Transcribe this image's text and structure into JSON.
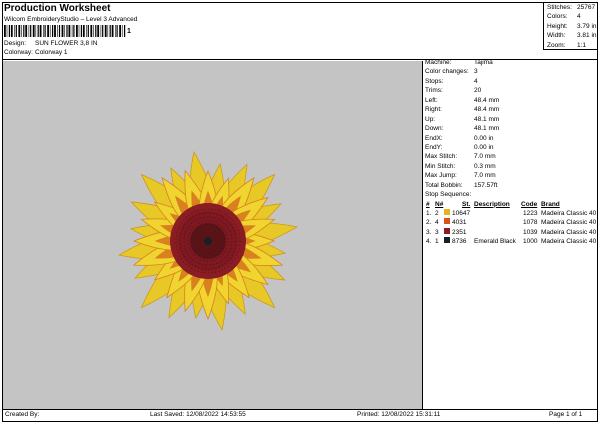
{
  "header": {
    "title": "Production Worksheet",
    "subtitle": "Wilcom EmbroideryStudio – Level 3 Advanced",
    "barcode_number": "1",
    "design_label": "Design:",
    "design_value": "SUN FLOWER 3,8 IN",
    "colorway_label": "Colorway:",
    "colorway_value": "Colorway 1"
  },
  "stats": [
    {
      "label": "Stitches:",
      "value": "25767"
    },
    {
      "label": "Colors:",
      "value": "4"
    },
    {
      "label": "Height:",
      "value": "3.79 in"
    },
    {
      "label": "Width:",
      "value": "3.81 in"
    },
    {
      "label": "Zoom:",
      "value": "1:1"
    }
  ],
  "machine_info": [
    {
      "label": "Machine:",
      "value": "Tajima"
    },
    {
      "label": "Color changes:",
      "value": "3"
    },
    {
      "label": "Stops:",
      "value": "4"
    },
    {
      "label": "Trims:",
      "value": "20"
    },
    {
      "label": "Left:",
      "value": "48.4 mm"
    },
    {
      "label": "Right:",
      "value": "48.4 mm"
    },
    {
      "label": "Up:",
      "value": "48.1 mm"
    },
    {
      "label": "Down:",
      "value": "48.1 mm"
    },
    {
      "label": "EndX:",
      "value": "0.00 in"
    },
    {
      "label": "EndY:",
      "value": "0.00 in"
    },
    {
      "label": "Max Stitch:",
      "value": "7.0 mm"
    },
    {
      "label": "Min Stitch:",
      "value": "0.3 mm"
    },
    {
      "label": "Max Jump:",
      "value": "7.0 mm"
    },
    {
      "label": "Total Bobbin:",
      "value": "157.57ft"
    }
  ],
  "stop_sequence": {
    "title": "Stop Sequence:",
    "headers": {
      "num": "#",
      "n": "N#",
      "st": "St.",
      "description": "Description",
      "code": "Code",
      "brand": "Brand"
    },
    "rows": [
      {
        "num": "1.",
        "n": "2",
        "color": "#e8b21c",
        "st": "10647",
        "description": "",
        "code": "1223",
        "brand": "Madeira Classic 40"
      },
      {
        "num": "2.",
        "n": "4",
        "color": "#d9531e",
        "st": "4031",
        "description": "",
        "code": "1078",
        "brand": "Madeira Classic 40"
      },
      {
        "num": "3.",
        "n": "3",
        "color": "#8a1c24",
        "st": "2351",
        "description": "",
        "code": "1039",
        "brand": "Madeira Classic 40"
      },
      {
        "num": "4.",
        "n": "1",
        "color": "#15202a",
        "st": "8736",
        "description": "Emerald Black",
        "code": "1000",
        "brand": "Madeira Classic 40"
      }
    ]
  },
  "footer": {
    "created_by": "Created By:",
    "last_saved": "Last Saved: 12/08/2022 14:53:55",
    "printed": "Printed: 12/08/2022 15:31:11",
    "page": "Page 1 of 1"
  },
  "colors": {
    "canvas": "#c4c4c4",
    "petal_yellow": "#e8c826",
    "petal_orange": "#d9811e",
    "center_red": "#8a1c24",
    "center_dark": "#2a1416"
  }
}
